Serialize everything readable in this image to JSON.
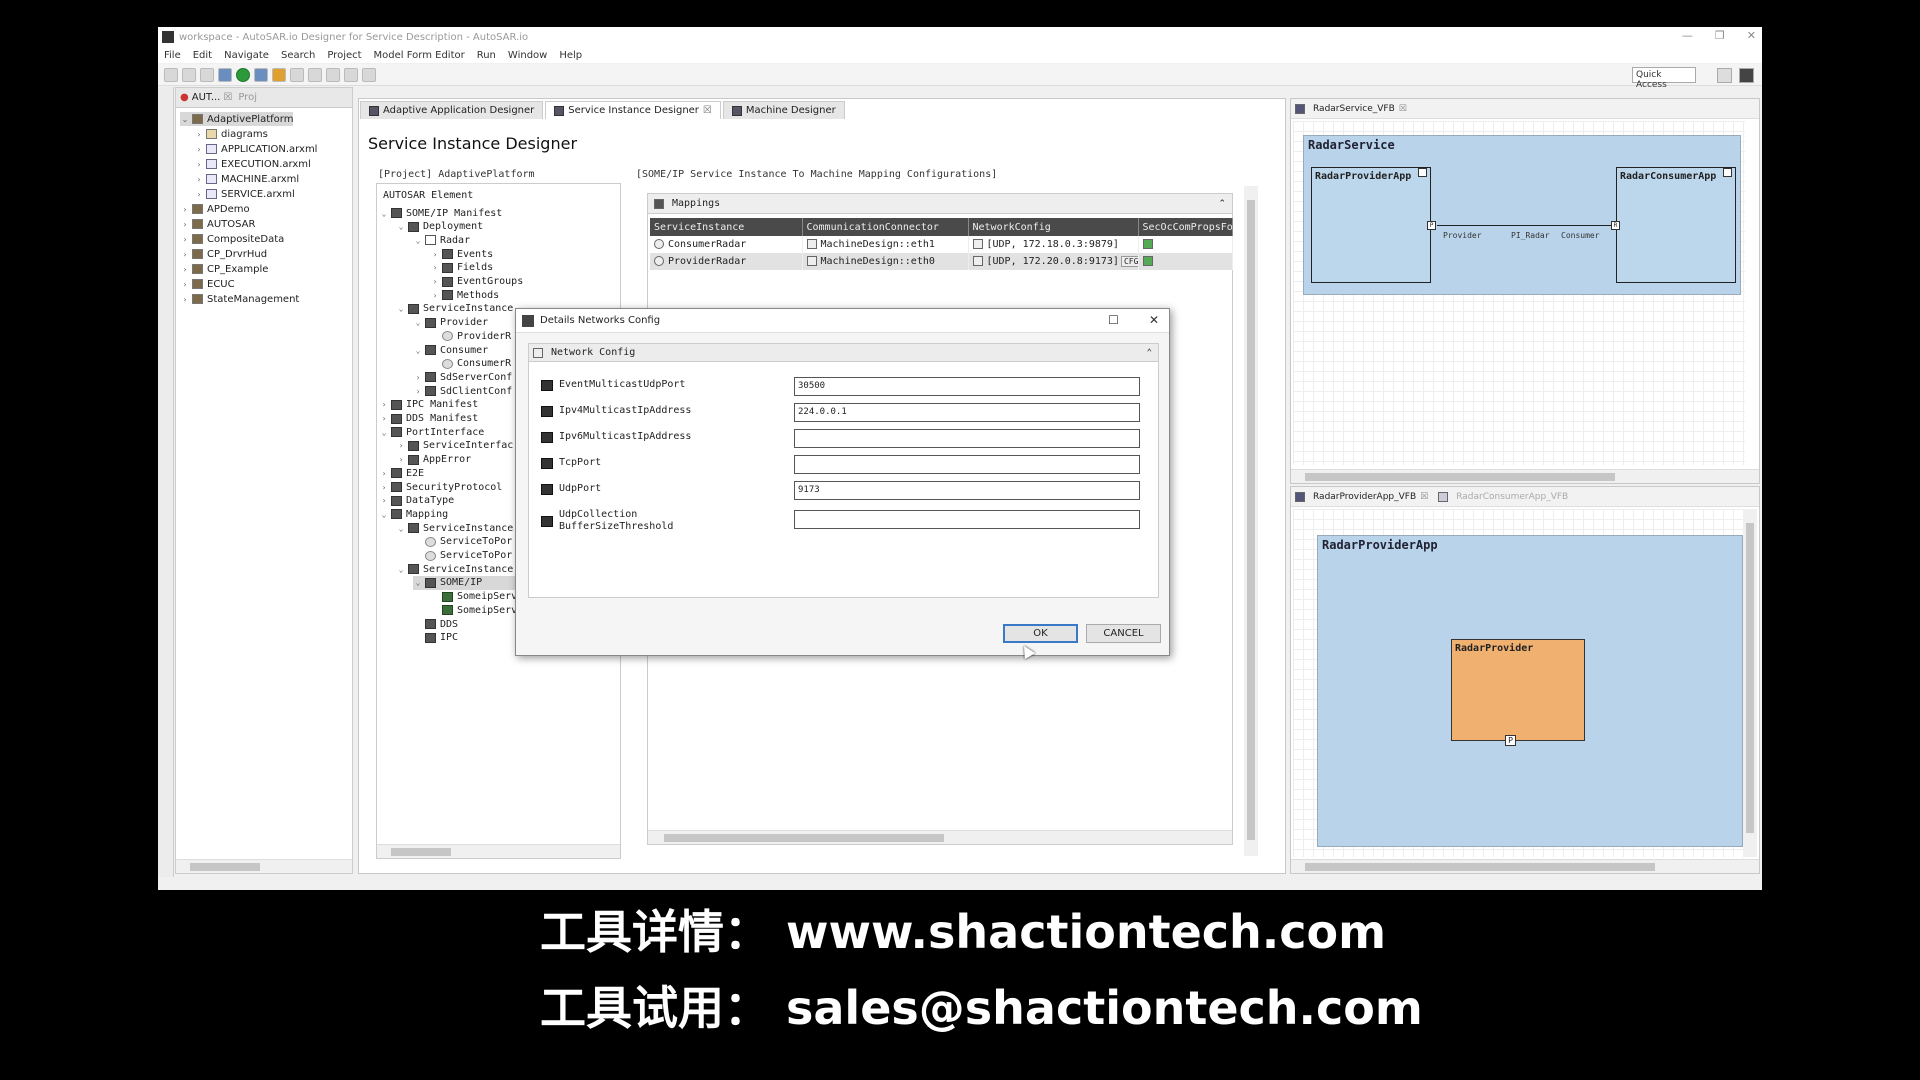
{
  "window": {
    "title": "workspace - AutoSAR.io Designer for Service Description - AutoSAR.io"
  },
  "menu": [
    "File",
    "Edit",
    "Navigate",
    "Search",
    "Project",
    "Model Form Editor",
    "Run",
    "Window",
    "Help"
  ],
  "quick_access": "Quick Access",
  "explorer": {
    "tabs": [
      "AUT...",
      "Proj"
    ],
    "items": [
      {
        "label": "AdaptivePlatform",
        "depth": 0,
        "arrow": "v",
        "icon": "p",
        "sel": true
      },
      {
        "label": "diagrams",
        "depth": 1,
        "arrow": ">",
        "icon": "f"
      },
      {
        "label": "APPLICATION.arxml",
        "depth": 1,
        "arrow": ">",
        "icon": "x"
      },
      {
        "label": "EXECUTION.arxml",
        "depth": 1,
        "arrow": ">",
        "icon": "x"
      },
      {
        "label": "MACHINE.arxml",
        "depth": 1,
        "arrow": ">",
        "icon": "x"
      },
      {
        "label": "SERVICE.arxml",
        "depth": 1,
        "arrow": ">",
        "icon": "x"
      },
      {
        "label": "APDemo",
        "depth": 0,
        "arrow": ">",
        "icon": "p"
      },
      {
        "label": "AUTOSAR",
        "depth": 0,
        "arrow": ">",
        "icon": "p"
      },
      {
        "label": "CompositeData",
        "depth": 0,
        "arrow": ">",
        "icon": "p"
      },
      {
        "label": "CP_DrvrHud",
        "depth": 0,
        "arrow": ">",
        "icon": "p"
      },
      {
        "label": "CP_Example",
        "depth": 0,
        "arrow": ">",
        "icon": "p"
      },
      {
        "label": "ECUC",
        "depth": 0,
        "arrow": ">",
        "icon": "p"
      },
      {
        "label": "StateManagement",
        "depth": 0,
        "arrow": ">",
        "icon": "p"
      }
    ]
  },
  "editor_tabs": [
    {
      "label": "Adaptive Application Designer",
      "active": false
    },
    {
      "label": "Service Instance Designer",
      "active": true,
      "close": "☒"
    },
    {
      "label": "Machine Designer",
      "active": false
    }
  ],
  "designer": {
    "title": "Service Instance Designer",
    "project_label": "[Project] AdaptivePlatform",
    "mapping_label": "[SOME/IP Service Instance To Machine Mapping Configurations]",
    "tree_header": "AUTOSAR Element"
  },
  "element_tree": [
    {
      "label": "SOME/IP Manifest",
      "depth": 0,
      "arrow": "v",
      "icon": "d"
    },
    {
      "label": "Deployment",
      "depth": 1,
      "arrow": "v",
      "icon": "d"
    },
    {
      "label": "Radar",
      "depth": 2,
      "arrow": "v",
      "icon": "s"
    },
    {
      "label": "Events",
      "depth": 3,
      "arrow": ">",
      "icon": "d"
    },
    {
      "label": "Fields",
      "depth": 3,
      "arrow": ">",
      "icon": "d"
    },
    {
      "label": "EventGroups",
      "depth": 3,
      "arrow": ">",
      "icon": "d"
    },
    {
      "label": "Methods",
      "depth": 3,
      "arrow": ">",
      "icon": "d"
    },
    {
      "label": "ServiceInstance",
      "depth": 1,
      "arrow": "v",
      "icon": "d"
    },
    {
      "label": "Provider",
      "depth": 2,
      "arrow": "v",
      "icon": "d"
    },
    {
      "label": "ProviderR",
      "depth": 3,
      "arrow": "",
      "icon": "c"
    },
    {
      "label": "Consumer",
      "depth": 2,
      "arrow": "v",
      "icon": "d"
    },
    {
      "label": "ConsumerR",
      "depth": 3,
      "arrow": "",
      "icon": "c"
    },
    {
      "label": "SdServerConf",
      "depth": 2,
      "arrow": ">",
      "icon": "d"
    },
    {
      "label": "SdClientConf",
      "depth": 2,
      "arrow": ">",
      "icon": "d"
    },
    {
      "label": "IPC Manifest",
      "depth": 0,
      "arrow": ">",
      "icon": "d"
    },
    {
      "label": "DDS Manifest",
      "depth": 0,
      "arrow": ">",
      "icon": "d"
    },
    {
      "label": "PortInterface",
      "depth": 0,
      "arrow": "v",
      "icon": "d"
    },
    {
      "label": "ServiceInterfac",
      "depth": 1,
      "arrow": ">",
      "icon": "d"
    },
    {
      "label": "AppError",
      "depth": 1,
      "arrow": ">",
      "icon": "d"
    },
    {
      "label": "E2E",
      "depth": 0,
      "arrow": ">",
      "icon": "d"
    },
    {
      "label": "SecurityProtocol",
      "depth": 0,
      "arrow": ">",
      "icon": "d"
    },
    {
      "label": "DataType",
      "depth": 0,
      "arrow": ">",
      "icon": "d"
    },
    {
      "label": "Mapping",
      "depth": 0,
      "arrow": "v",
      "icon": "d"
    },
    {
      "label": "ServiceInstance",
      "depth": 1,
      "arrow": "v",
      "icon": "d"
    },
    {
      "label": "ServiceToPor",
      "depth": 2,
      "arrow": "",
      "icon": "c"
    },
    {
      "label": "ServiceToPor",
      "depth": 2,
      "arrow": "",
      "icon": "c"
    },
    {
      "label": "ServiceInstance",
      "depth": 1,
      "arrow": "v",
      "icon": "d"
    },
    {
      "label": "SOME/IP",
      "depth": 2,
      "arrow": "v",
      "icon": "d",
      "sel": true
    },
    {
      "label": "SomeipServiceToMachine_Cons",
      "depth": 3,
      "arrow": "",
      "icon": "m"
    },
    {
      "label": "SomeipServiceToMachine_Prov",
      "depth": 3,
      "arrow": "",
      "icon": "m"
    },
    {
      "label": "DDS",
      "depth": 2,
      "arrow": "",
      "icon": "d"
    },
    {
      "label": "IPC",
      "depth": 2,
      "arrow": "",
      "icon": "d"
    }
  ],
  "mappings": {
    "title": "Mappings",
    "columns": [
      "ServiceInstance",
      "CommunicationConnector",
      "NetworkConfig",
      "SecOcComPropsFo"
    ],
    "rows": [
      {
        "instance": "ConsumerRadar",
        "connector": "MachineDesign::eth1",
        "network": "[UDP, 172.18.0.3:9879]",
        "cfg": ""
      },
      {
        "instance": "ProviderRadar",
        "connector": "MachineDesign::eth0",
        "network": "[UDP, 172.20.0.8:9173]",
        "cfg": "CFG"
      }
    ]
  },
  "dialog": {
    "title": "Details Networks Config",
    "section": "Network Config",
    "fields": [
      {
        "label": "EventMulticastUdpPort",
        "value": "30500"
      },
      {
        "label": "Ipv4MulticastIpAddress",
        "value": "224.0.0.1"
      },
      {
        "label": "Ipv6MulticastIpAddress",
        "value": ""
      },
      {
        "label": "TcpPort",
        "value": ""
      },
      {
        "label": "UdpPort",
        "value": "9173"
      },
      {
        "label": "UdpCollection\nBufferSizeThreshold",
        "value": ""
      }
    ],
    "ok": "OK",
    "cancel": "CANCEL"
  },
  "right_top": {
    "tab": "RadarService_VFB",
    "vfb_title": "RadarService",
    "provider": "RadarProviderApp",
    "consumer": "RadarConsumerApp",
    "conn_provider": "Provider",
    "conn_mid": "PI_Radar",
    "conn_consumer": "Consumer"
  },
  "right_bottom": {
    "tabs": [
      "RadarProviderApp_VFB",
      "RadarConsumerApp_VFB"
    ],
    "vfb_title": "RadarProviderApp",
    "component": "RadarProvider",
    "port": "P"
  },
  "caption": {
    "line1": "工具详情： www.shactiontech.com",
    "line2": "工具试用： sales@shactiontech.com"
  }
}
